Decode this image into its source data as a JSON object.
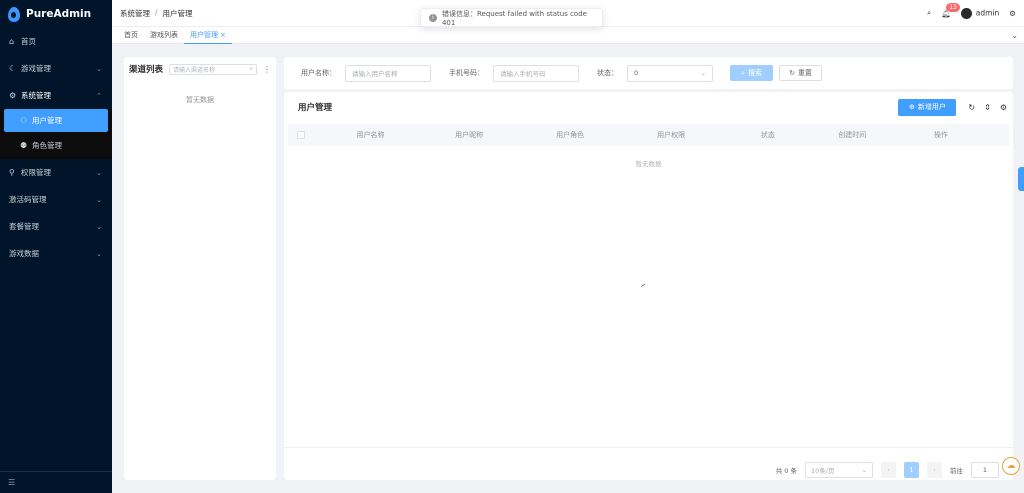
{
  "app": {
    "title": "PureAdmin"
  },
  "sidebar": {
    "items": [
      {
        "label": "首页",
        "icon": "home-icon"
      },
      {
        "label": "游戏管理",
        "icon": "moon-icon"
      },
      {
        "label": "系统管理",
        "icon": "gear-icon"
      },
      {
        "label": "权限管理",
        "icon": "key-icon"
      },
      {
        "label": "激活码管理",
        "icon": ""
      },
      {
        "label": "套餐管理",
        "icon": ""
      },
      {
        "label": "游戏数据",
        "icon": ""
      }
    ],
    "submenu": [
      {
        "label": "用户管理",
        "icon": "user-icon"
      },
      {
        "label": "角色管理",
        "icon": "users-icon"
      }
    ]
  },
  "header": {
    "breadcrumb": [
      "系统管理",
      "用户管理"
    ],
    "notification_count": "13",
    "username": "admin"
  },
  "tabs": [
    {
      "label": "首页"
    },
    {
      "label": "游戏列表"
    },
    {
      "label": "用户管理"
    }
  ],
  "toast": {
    "message": "错误信息：Request failed with status code 401"
  },
  "channel": {
    "title": "渠道列表",
    "search_placeholder": "请输入渠道名称",
    "empty_text": "暂无数据"
  },
  "form": {
    "username_label": "用户名称：",
    "username_placeholder": "请输入用户名称",
    "phone_label": "手机号码：",
    "phone_placeholder": "请输入手机号码",
    "status_label": "状态：",
    "status_value": "0",
    "search_button": "搜索",
    "reset_button": "重置"
  },
  "table": {
    "title": "用户管理",
    "add_button": "新增用户",
    "columns": [
      "用户名称",
      "用户昵称",
      "用户角色",
      "用户权限",
      "状态",
      "创建时间",
      "操作"
    ],
    "empty_text": "暂无数据"
  },
  "pagination": {
    "total": "共 0 条",
    "page_size": "10条/页",
    "current_page": "1",
    "goto_label": "前往",
    "goto_value": "1"
  },
  "colors": {
    "primary": "#409eff",
    "sidebar_bg": "#001529",
    "badge": "#f56c6c"
  }
}
